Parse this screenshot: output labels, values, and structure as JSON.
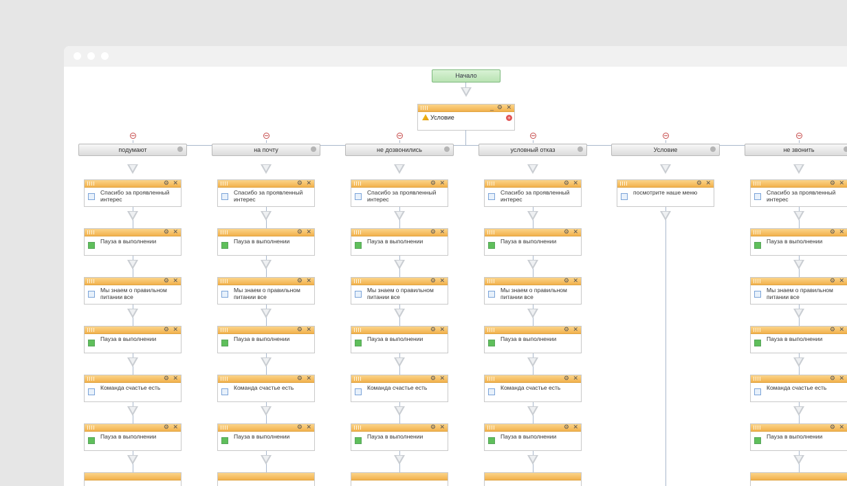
{
  "start_label": "Начало",
  "condition_label": "Условие",
  "branches": [
    {
      "label": "подумают",
      "steps": [
        "Спасибо за проявленный интерес",
        "Пауза в выполнении",
        "Мы знаем о правильном питании все",
        "Пауза в выполнении",
        "Команда счастье есть",
        "Пауза в выполнении"
      ]
    },
    {
      "label": "на почту",
      "steps": [
        "Спасибо за проявленный интерес",
        "Пауза в выполнении",
        "Мы знаем о правильном питании все",
        "Пауза в выполнении",
        "Команда счастье есть",
        "Пауза в выполнении"
      ]
    },
    {
      "label": "не дозвонились",
      "steps": [
        "Спасибо за проявленный интерес",
        "Пауза в выполнении",
        "Мы знаем о правильном питании все",
        "Пауза в выполнении",
        "Команда счастье есть",
        "Пауза в выполнении"
      ]
    },
    {
      "label": "условный отказ",
      "steps": [
        "Спасибо за проявленный интерес",
        "Пауза в выполнении",
        "Мы знаем о правильном питании все",
        "Пауза в выполнении",
        "Команда счастье есть",
        "Пауза в выполнении"
      ]
    },
    {
      "label": "Условие",
      "steps": [
        "посмотрите наше меню"
      ]
    },
    {
      "label": "не звонить",
      "steps": [
        "Спасибо за проявленный интерес",
        "Пауза в выполнении",
        "Мы знаем о правильном питании все",
        "Пауза в выполнении",
        "Команда счастье есть",
        "Пауза в выполнении"
      ]
    }
  ]
}
